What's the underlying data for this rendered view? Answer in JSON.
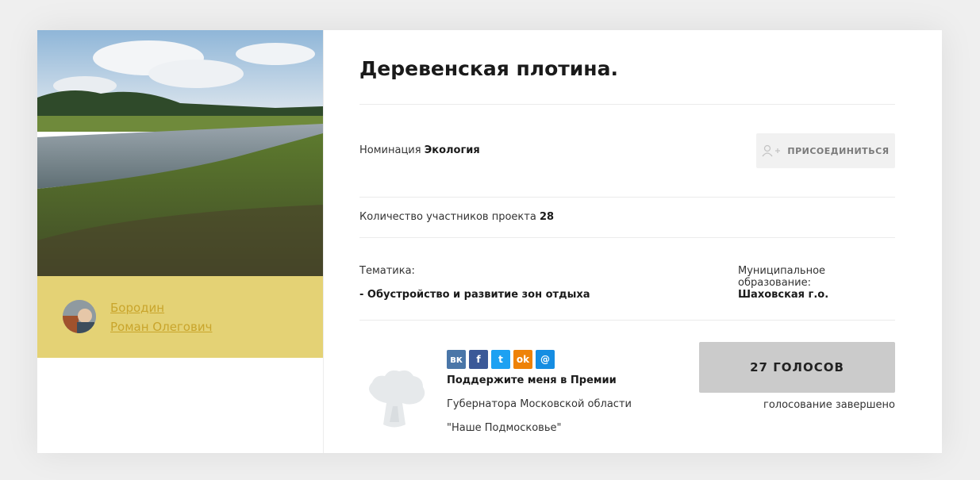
{
  "project": {
    "title": "Деревенская плотина.",
    "nomination_label": "Номинация",
    "nomination_value": "Экология",
    "participants_label": "Количество участников проекта",
    "participants_value": "28",
    "theme_label": "Тематика:",
    "theme_value": "- Обустройство и развитие зон отдыха",
    "municipality_label": "Муниципальное образование:",
    "municipality_value": "Шаховская г.о."
  },
  "author": {
    "first_line": "Бородин",
    "second_line": "Роман Олегович"
  },
  "actions": {
    "join_label": "ПРИСОЕДИНИТЬСЯ",
    "votes_label": "27 ГОЛОСОВ",
    "vote_status": "голосование завершено"
  },
  "support": {
    "headline": "Поддержите меня в Премии",
    "line2": "Губернатора Московской области",
    "line3": "\"Наше Подмосковье\""
  },
  "social": [
    {
      "name": "vk-icon",
      "glyph": "вк",
      "color": "#4a76a8"
    },
    {
      "name": "facebook-icon",
      "glyph": "f",
      "color": "#3b5998"
    },
    {
      "name": "twitter-icon",
      "glyph": "t",
      "color": "#1da1f2"
    },
    {
      "name": "odnoklassniki-icon",
      "glyph": "ok",
      "color": "#ee8208"
    },
    {
      "name": "mailru-icon",
      "glyph": "@",
      "color": "#168de2"
    }
  ],
  "colors": {
    "author_bg": "#e4d275",
    "author_link": "#c9a52c",
    "vote_button_bg": "#cbcbcb"
  }
}
